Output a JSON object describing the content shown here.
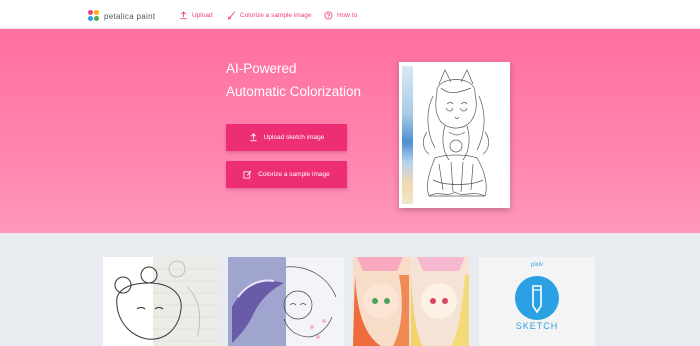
{
  "brand": {
    "name": "petalica paint"
  },
  "nav": [
    {
      "label": "Upload",
      "icon": "upload-icon"
    },
    {
      "label": "Colorize a sample image",
      "icon": "brush-icon"
    },
    {
      "label": "How to",
      "icon": "help-icon"
    }
  ],
  "hero": {
    "title_line1": "AI-Powered",
    "title_line2": "Automatic Colorization",
    "upload_button": "Upload sketch image",
    "sample_button": "Colorize a sample image"
  },
  "gallery": {
    "pixiv_label": "pixiv",
    "sketch_label": "SKETCH"
  },
  "colors": {
    "accent": "#f0407a",
    "hero_top": "#ff6fa1",
    "hero_bottom": "#ff97bc",
    "button": "#ee2e74",
    "gallery_bg": "#e8ebef",
    "pixiv_blue": "#2ba1e3"
  }
}
